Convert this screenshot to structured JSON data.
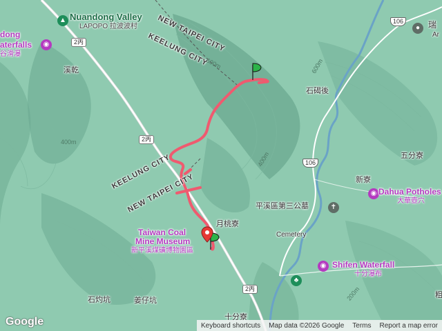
{
  "labels": {
    "nuandong_en": "Nuandong Valley",
    "nuandong_zh": "LAPOPO 拉波波村",
    "waterfalls_en_1": "dong",
    "waterfalls_en_2": "aterfalls",
    "waterfalls_zh": "谷滑瀑",
    "xiqian": "溪乾",
    "shijiehou": "石碣後",
    "wufenliao": "五分寮",
    "xinliao": "新寮",
    "yuetaoliao": "月桃寮",
    "cemetery_zh": "平溪區第三公墓",
    "cemetery_en": "Cemetery",
    "dahua_en": "Dahua Potholes",
    "dahua_zh": "大華壺穴",
    "shifen_en": "Shifen Waterfall",
    "shifen_zh": "十分瀑布",
    "museum_en_1": "Taiwan Coal",
    "museum_en_2": "Mine Museum",
    "museum_zh": "新平溪煤礦博物園區",
    "shizhuokeng": "石灼坑",
    "jiangzikeng": "姜仔坑",
    "shifenliao": "十分寮",
    "ruifang_zh": "瑞",
    "ruifang_en": "Ar",
    "edge_zh": "粗",
    "keelung_top": "KEELUNG CITY",
    "newtaipei_top": "NEW TAIPEI CITY",
    "keelung_bottom": "KEELUNG CITY",
    "newtaipei_bottom": "NEW TAIPEI CITY"
  },
  "roads": {
    "r2bing_a": "2丙",
    "r2bing_b": "2丙",
    "r2bing_c": "2丙",
    "r106_a": "106",
    "r106_b": "106"
  },
  "contours": {
    "c600": "600m",
    "c400a": "400m",
    "c400b": "400m",
    "c600b": "600m",
    "c200": "200m"
  },
  "footer": {
    "logo": "Google",
    "shortcuts": "Keyboard shortcuts",
    "map_data": "Map data ©2026 Google",
    "terms": "Terms",
    "report": "Report a map error"
  },
  "colors": {
    "track": "#ef5a6f",
    "terrain": "#8fcab0",
    "marker_green": "#2db34a",
    "marker_red": "#e53935",
    "poi": "#b43ac0"
  }
}
